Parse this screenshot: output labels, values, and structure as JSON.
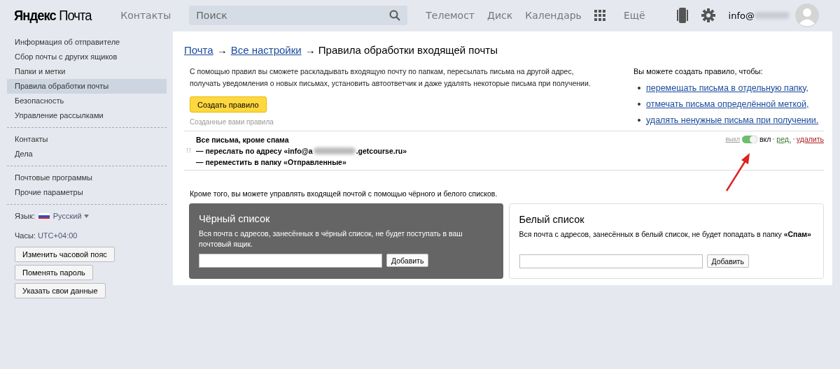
{
  "header": {
    "logo": {
      "brand": "Яндекс",
      "product": "Почта"
    },
    "contacts": "Контакты",
    "search": {
      "placeholder": "Поиск"
    },
    "nav": [
      "Телемост",
      "Диск",
      "Календарь"
    ],
    "more": "Ещё",
    "user": {
      "login": "info@",
      "redacted": true
    }
  },
  "sidebar": {
    "groups": [
      [
        {
          "label": "Информация об отправителе",
          "selected": false
        },
        {
          "label": "Сбор почты с других ящиков",
          "selected": false
        },
        {
          "label": "Папки и метки",
          "selected": false
        },
        {
          "label": "Правила обработки почты",
          "selected": true
        },
        {
          "label": "Безопасность",
          "selected": false
        },
        {
          "label": "Управление рассылками",
          "selected": false
        }
      ],
      [
        {
          "label": "Контакты",
          "selected": false
        },
        {
          "label": "Дела",
          "selected": false
        }
      ],
      [
        {
          "label": "Почтовые программы",
          "selected": false
        },
        {
          "label": "Прочие параметры",
          "selected": false
        }
      ]
    ],
    "language": {
      "label": "Язык:",
      "value": "Русский"
    },
    "clock": {
      "label": "Часы:",
      "value": "UTC+04:00"
    },
    "buttons": [
      "Изменить часовой пояс",
      "Поменять пароль",
      "Указать свои данные"
    ]
  },
  "main": {
    "breadcrumb": [
      {
        "text": "Почта",
        "link": true
      },
      {
        "text": "→",
        "link": false
      },
      {
        "text": "Все настройки",
        "link": true
      },
      {
        "text": "→ Правила обработки входящей почты",
        "link": false
      }
    ],
    "intro": "С помощью правил вы сможете раскладывать входящую почту по папкам, пересылать письма на другой адрес, получать уведомления о новых письмах, установить автоответчик и даже удалять некоторые письма при получении.",
    "create_button": "Создать правило",
    "hints": {
      "title": "Вы можете создать правило, чтобы:",
      "items": [
        "перемещать письма в отдельную папку,",
        "отмечать письма определённой меткой,",
        "удалять ненужные письма при получении."
      ]
    },
    "rules_caption": "Созданные вами правила",
    "rules": [
      {
        "title": "Все письма, кроме спама",
        "lines": [
          {
            "text": "— переслать по адресу «info@a",
            "redacted": true,
            "tail": ".getcourse.ru»"
          },
          {
            "text": "— переместить в папку «Отправленные»",
            "redacted": false
          }
        ],
        "enabled": true,
        "off_label": "выкл",
        "on_label": "вкл",
        "edit": "ред.",
        "delete": "удалить"
      }
    ],
    "lists_intro": "Кроме того, вы можете управлять входящей почтой с помощью чёрного и белого списков.",
    "lists": [
      {
        "kind": "dark",
        "title": "Чёрный список",
        "description": "Вся почта с адресов, занесённых в чёрный список, не будет поступать в ваш почтовый ящик.",
        "button": "Добавить"
      },
      {
        "kind": "light",
        "title": "Белый список",
        "description": "Вся почта с адресов, занесённых в белый список, не будет попадать в папку **«Спам»**",
        "button": "Добавить"
      }
    ]
  }
}
